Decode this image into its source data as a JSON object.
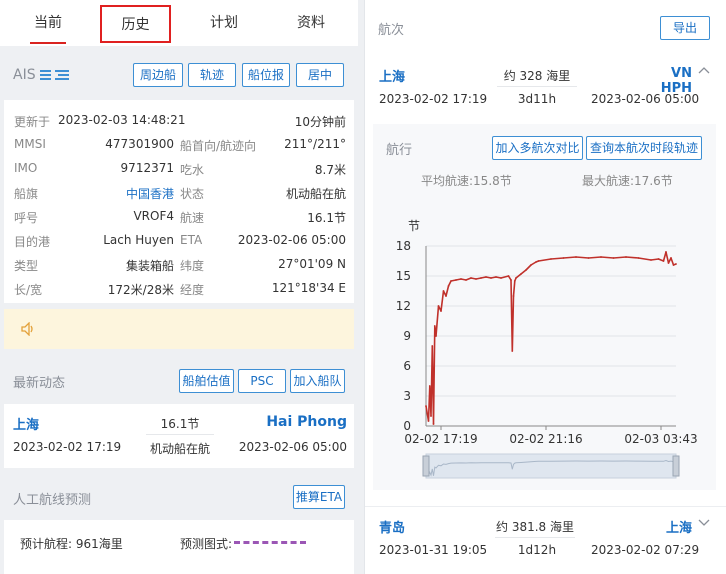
{
  "tabs": [
    "当前",
    "历史",
    "计划",
    "资料"
  ],
  "ais": {
    "title": "AIS",
    "buttons": [
      "周边船",
      "轨迹",
      "船位报",
      "居中"
    ],
    "updated_label": "更新于",
    "updated_time": "2023-02-03 14:48:21",
    "updated_ago": "10分钟前",
    "rows": [
      {
        "l1": "MMSI",
        "v1": "477301900",
        "l2": "船首向/航迹向",
        "v2": "211°/211°"
      },
      {
        "l1": "IMO",
        "v1": "9712371",
        "l2": "吃水",
        "v2": "8.7米"
      },
      {
        "l1": "船旗",
        "v1": "中国香港",
        "l2": "状态",
        "v2": "机动船在航"
      },
      {
        "l1": "呼号",
        "v1": "VROF4",
        "l2": "航速",
        "v2": "16.1节"
      },
      {
        "l1": "目的港",
        "v1": "Lach Huyen",
        "l2": "ETA",
        "v2": "2023-02-06 05:00"
      },
      {
        "l1": "类型",
        "v1": "集装箱船",
        "l2": "纬度",
        "v2": "27°01'09 N"
      },
      {
        "l1": "长/宽",
        "v1": "172米/28米",
        "l2": "经度",
        "v2": "121°18'34 E"
      }
    ]
  },
  "latest": {
    "title": "最新动态",
    "buttons": [
      "船舶估值",
      "PSC",
      "加入船队"
    ],
    "from_port": "上海",
    "to_port": "Hai Phong",
    "speed": "16.1节",
    "status": "机动船在航",
    "depart": "2023-02-02 17:19",
    "arrive": "2023-02-06 05:00"
  },
  "route_predict": {
    "title": "人工航线预测",
    "button": "推算ETA",
    "distance_label": "预计航程: 961海里",
    "legend_label": "预测图式:"
  },
  "voyage": {
    "title": "航次",
    "export": "导出",
    "first": {
      "from": "上海",
      "to": "VN HPH",
      "distance": "约 328 海里",
      "duration": "3d11h",
      "depart": "2023-02-02 17:19",
      "arrive": "2023-02-06 05:00"
    },
    "sailing_label": "航行",
    "compare_btn": "加入多航次对比",
    "track_btn": "查询本航次时段轨迹",
    "avg_speed": "平均航速:15.8节",
    "max_speed": "最大航速:17.6节",
    "second": {
      "from": "青岛",
      "to": "上海",
      "distance": "约 381.8 海里",
      "duration": "1d12h",
      "depart": "2023-01-31 19:05",
      "arrive": "2023-02-02 07:29"
    }
  },
  "chart_data": {
    "type": "line",
    "ylabel": "节",
    "ylim": [
      0,
      18
    ],
    "yticks": [
      0,
      3,
      6,
      9,
      12,
      15,
      18
    ],
    "xtick_labels": [
      "02-02 17:19",
      "02-02 21:16",
      "02-03 03:43"
    ],
    "series": [
      {
        "color": "#c0312b",
        "x": [
          0,
          0.01,
          0.015,
          0.02,
          0.025,
          0.03,
          0.035,
          0.04,
          0.05,
          0.06,
          0.07,
          0.08,
          0.09,
          0.1,
          0.12,
          0.14,
          0.16,
          0.18,
          0.2,
          0.22,
          0.24,
          0.26,
          0.28,
          0.3,
          0.33,
          0.34,
          0.345,
          0.35,
          0.355,
          0.36,
          0.38,
          0.4,
          0.42,
          0.44,
          0.45,
          0.5,
          0.55,
          0.6,
          0.65,
          0.7,
          0.75,
          0.8,
          0.85,
          0.9,
          0.93,
          0.95,
          0.96,
          0.97,
          0.98,
          0.99,
          1.0
        ],
        "values": [
          2,
          0.5,
          4,
          1,
          8,
          0.2,
          10,
          9,
          12,
          11.5,
          13.5,
          13,
          14,
          14.5,
          14.6,
          14.7,
          14.6,
          14.8,
          14.7,
          14.8,
          14.9,
          14.8,
          14.9,
          14.8,
          15.0,
          14.6,
          7.5,
          13,
          14.5,
          14.8,
          15.2,
          15.6,
          16.1,
          16.4,
          16.5,
          16.7,
          16.8,
          16.9,
          16.8,
          16.9,
          16.8,
          16.9,
          16.8,
          16.6,
          16.7,
          16.5,
          17.4,
          16.3,
          16.8,
          16.1,
          16.2
        ]
      }
    ]
  }
}
